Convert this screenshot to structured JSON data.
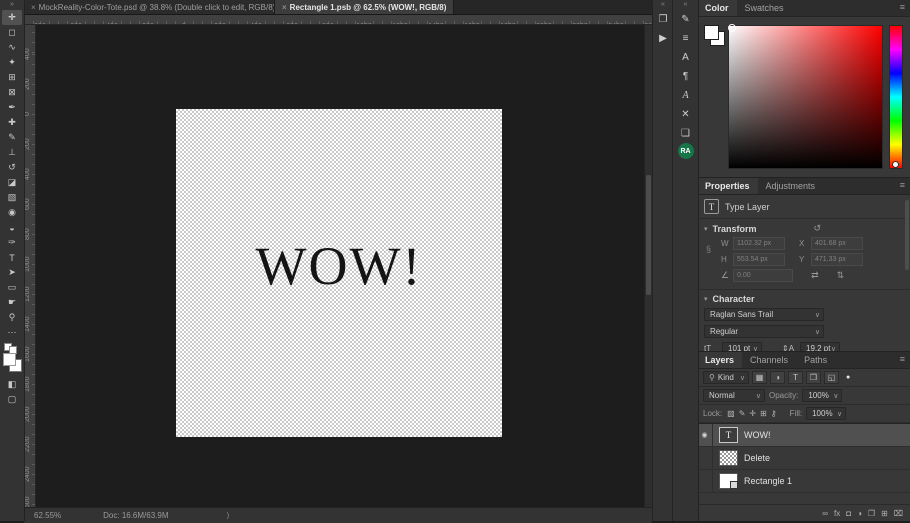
{
  "window": {
    "tabs": [
      {
        "close": "×",
        "label": "MockReality-Color-Tote.psd @ 38.8% (Double click to edit, RGB/8) *"
      },
      {
        "close": "×",
        "label": "Rectangle 1.psb @ 62.5% (WOW!, RGB/8)",
        "cls": "active"
      }
    ]
  },
  "toolbar": {
    "collapse_glyph": "»",
    "tools_upper": [
      {
        "name": "move-tool",
        "glyph": "✛",
        "cls": "active"
      },
      {
        "name": "marquee-tool",
        "glyph": "◻"
      },
      {
        "name": "lasso-tool",
        "glyph": "∿"
      },
      {
        "name": "object-selection-tool",
        "glyph": "✦"
      },
      {
        "name": "crop-tool",
        "glyph": "⊞"
      },
      {
        "name": "frame-tool",
        "glyph": "⊠"
      },
      {
        "name": "eyedropper-tool",
        "glyph": "✒"
      },
      {
        "name": "healing-brush-tool",
        "glyph": "✚"
      },
      {
        "name": "brush-tool",
        "glyph": "✎"
      },
      {
        "name": "clone-stamp-tool",
        "glyph": "⊥"
      },
      {
        "name": "history-brush-tool",
        "glyph": "↺"
      },
      {
        "name": "eraser-tool",
        "glyph": "◪"
      },
      {
        "name": "gradient-tool",
        "glyph": "▧"
      },
      {
        "name": "blur-tool",
        "glyph": "◉"
      },
      {
        "name": "dodge-tool",
        "glyph": "◒"
      },
      {
        "name": "pen-tool",
        "glyph": "✑"
      },
      {
        "name": "type-tool",
        "glyph": "T"
      },
      {
        "name": "path-select-tool",
        "glyph": "➤"
      },
      {
        "name": "shape-tool",
        "glyph": "▭"
      },
      {
        "name": "hand-tool",
        "glyph": "☛"
      },
      {
        "name": "zoom-tool",
        "glyph": "⚲"
      },
      {
        "name": "edit-toolbar-icon",
        "glyph": "⋯"
      }
    ],
    "tools_lower": [
      {
        "name": "quick-mask-mode-button",
        "glyph": "◧"
      },
      {
        "name": "screen-mode-button",
        "glyph": "▢"
      }
    ],
    "fg_color": "#ffffff",
    "bg_color": "#ffffff"
  },
  "rulers": {
    "top": [
      "800",
      "600",
      "400",
      "200",
      "0",
      "200",
      "400",
      "600",
      "800",
      "1000",
      "1200",
      "1400",
      "1600",
      "1800",
      "2000",
      "2200",
      "2400",
      "2600"
    ],
    "left": [
      "400",
      "200",
      "0",
      "200",
      "400",
      "600",
      "800",
      "1000",
      "1200",
      "1400",
      "1600",
      "1800",
      "2000",
      "2200",
      "2400",
      "2600"
    ]
  },
  "canvas": {
    "text": "WOW!"
  },
  "statusbar": {
    "zoom_level": "62.55%",
    "doc_size": "Doc: 16.6M/63.9M",
    "arrow": "⟩"
  },
  "strips": {
    "collapse_glyph": "«",
    "a": [
      {
        "name": "history-panel-icon",
        "glyph": "❐"
      },
      {
        "name": "actions-panel-icon",
        "glyph": "▶"
      }
    ],
    "b": [
      {
        "name": "brush-settings-panel-icon",
        "glyph": "✎"
      },
      {
        "name": "clone-source-panel-icon",
        "glyph": "≡"
      },
      {
        "name": "character-panel-icon",
        "glyph": "A"
      },
      {
        "name": "paragraph-panel-icon",
        "glyph": "¶"
      },
      {
        "name": "glyphs-panel-icon",
        "glyph": "A",
        "cls": "italic"
      },
      {
        "name": "tool-presets-panel-icon",
        "glyph": "✕"
      },
      {
        "name": "libraries-panel-icon",
        "glyph": "❏"
      },
      {
        "name": "ra-badge",
        "glyph": "RA",
        "cls": "badge"
      }
    ]
  },
  "color_panel": {
    "tabs": [
      {
        "label": "Color",
        "cls": "active"
      },
      {
        "label": "Swatches"
      }
    ],
    "menu_icon": "≡"
  },
  "properties_panel": {
    "tabs": [
      {
        "label": "Properties",
        "cls": "active"
      },
      {
        "label": "Adjustments"
      }
    ],
    "menu_icon": "≡",
    "layer_type_icon": "T",
    "layer_type": "Type Layer",
    "transform": {
      "title": "Transform",
      "caret": "▾",
      "reset_icon": "↺",
      "link_icon": "§",
      "w_label": "W",
      "w_value": "1102.32 px",
      "x_label": "X",
      "x_value": "401.68 px",
      "h_label": "H",
      "h_value": "553.54 px",
      "y_label": "Y",
      "y_value": "471.33 px",
      "angle_icon": "∠",
      "angle_value": "0.00",
      "flip_h_icon": "⇄",
      "flip_v_icon": "⇅"
    },
    "character": {
      "title": "Character",
      "caret": "▾",
      "font_name": "Raglan Sans Trail",
      "font_style": "Regular",
      "size_icon": "tT",
      "size_value": "101 pt",
      "leading_icon": "⇕A",
      "leading_value": "19.2 pt"
    }
  },
  "layers_panel": {
    "tabs": [
      {
        "label": "Layers",
        "cls": "active"
      },
      {
        "label": "Channels"
      },
      {
        "label": "Paths"
      }
    ],
    "menu_icon": "≡",
    "filter": {
      "search_icon": "⚲",
      "kind_label": "Kind",
      "icons": [
        {
          "name": "filter-pixel-layers-icon",
          "glyph": "▦"
        },
        {
          "name": "filter-adjustment-layers-icon",
          "glyph": "◑"
        },
        {
          "name": "filter-type-layers-icon",
          "glyph": "T"
        },
        {
          "name": "filter-shape-layers-icon",
          "glyph": "❒"
        },
        {
          "name": "filter-smart-objects-icon",
          "glyph": "◱"
        }
      ],
      "toggle_icon": "●"
    },
    "blend_mode": "Normal",
    "opacity_label": "Opacity:",
    "opacity_value": "100%",
    "lock_label": "Lock:",
    "lock_icons": [
      {
        "name": "lock-transparent-pixels-icon",
        "glyph": "▨"
      },
      {
        "name": "lock-image-pixels-icon",
        "glyph": "✎"
      },
      {
        "name": "lock-position-icon",
        "glyph": "✛"
      },
      {
        "name": "lock-artboard-icon",
        "glyph": "⊞"
      },
      {
        "name": "lock-all-icon",
        "glyph": "⚷"
      }
    ],
    "fill_label": "Fill:",
    "fill_value": "100%",
    "eye_icon": "◉",
    "layers": [
      {
        "name": "WOW!",
        "thumb": "T",
        "cls": "selected t-text visible"
      },
      {
        "name": "Delete",
        "cls": "t-pattern"
      },
      {
        "name": "Rectangle 1",
        "cls": "t-white"
      }
    ],
    "bottom_icons": [
      {
        "name": "link-layers-icon",
        "glyph": "∞"
      },
      {
        "name": "layer-style-icon",
        "glyph": "fx"
      },
      {
        "name": "layer-mask-icon",
        "glyph": "◘"
      },
      {
        "name": "adjustment-layer-icon",
        "glyph": "◑"
      },
      {
        "name": "layer-group-icon",
        "glyph": "❐"
      },
      {
        "name": "new-layer-icon",
        "glyph": "⊞"
      },
      {
        "name": "delete-layer-icon",
        "glyph": "⌧"
      }
    ]
  },
  "colors": {
    "hue_red": "#ff0000",
    "badge_green": "#17754a",
    "foreground_swatch": "#ffffff",
    "background_swatch": "#ffffff",
    "text_color_swatch": "#ffffff"
  }
}
